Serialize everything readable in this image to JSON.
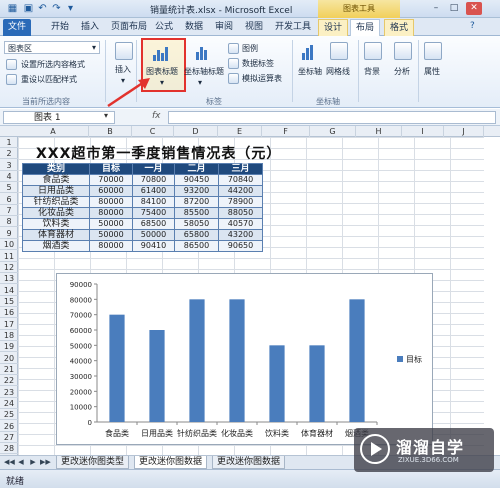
{
  "window": {
    "title": "销量统计表.xlsx - Microsoft Excel",
    "context_header": "图表工具",
    "min_label": "–",
    "max_label": "□",
    "close_label": "✕"
  },
  "tabs": [
    "文件",
    "开始",
    "插入",
    "页面布局",
    "公式",
    "数据",
    "审阅",
    "视图",
    "开发工具",
    "设计",
    "布局",
    "格式"
  ],
  "ribbon": {
    "chart_area_dropdown": "图表区",
    "format_selection": "设置所选内容格式",
    "reset_style": "重设以匹配样式",
    "group_current_selection": "当前所选内容",
    "insert": "插入",
    "chart_title": "图表标题",
    "axis_titles": "坐标轴标题",
    "legend": "图例",
    "data_labels": "数据标签",
    "data_table": "模拟运算表",
    "group_labels": "标签",
    "axes": "坐标轴",
    "gridlines": "网格线",
    "group_axes": "坐标轴",
    "background": "背景",
    "analysis": "分析",
    "properties": "属性"
  },
  "namebox": {
    "value": "图表 1"
  },
  "formula": {
    "fx": "fx",
    "value": ""
  },
  "columns": [
    "A",
    "B",
    "C",
    "D",
    "E",
    "F",
    "G",
    "H",
    "I",
    "J"
  ],
  "rows": [
    "1",
    "2",
    "3",
    "4",
    "5",
    "6",
    "7",
    "8",
    "9",
    "10",
    "11",
    "12",
    "13",
    "14",
    "15",
    "16",
    "17",
    "18",
    "19",
    "20",
    "21",
    "22",
    "23",
    "24",
    "25",
    "26",
    "27",
    "28"
  ],
  "sheet": {
    "title": "XXX超市第一季度销售情况表（元）",
    "headers": [
      "类别",
      "目标",
      "一月",
      "二月",
      "三月"
    ],
    "data": [
      [
        "食品类",
        "70000",
        "70800",
        "90450",
        "70840"
      ],
      [
        "日用品类",
        "60000",
        "61400",
        "93200",
        "44200"
      ],
      [
        "针纺织品类",
        "80000",
        "84100",
        "87200",
        "78900"
      ],
      [
        "化妆品类",
        "80000",
        "75400",
        "85500",
        "88050"
      ],
      [
        "饮料类",
        "50000",
        "68500",
        "58050",
        "40570"
      ],
      [
        "体育器材",
        "50000",
        "50000",
        "65800",
        "43200"
      ],
      [
        "烟酒类",
        "80000",
        "90410",
        "86500",
        "90650"
      ]
    ]
  },
  "chart_data": {
    "type": "bar",
    "categories": [
      "食品类",
      "日用品类",
      "针纺织品类",
      "化妆品类",
      "饮料类",
      "体育器材",
      "烟酒类"
    ],
    "series": [
      {
        "name": "目标",
        "values": [
          70000,
          60000,
          80000,
          80000,
          50000,
          50000,
          80000
        ],
        "color": "#4a7dbd"
      }
    ],
    "yticks": [
      "0",
      "10000",
      "20000",
      "30000",
      "40000",
      "50000",
      "60000",
      "70000",
      "80000",
      "90000"
    ],
    "ylim": [
      0,
      90000
    ],
    "legend": "right",
    "grid": false
  },
  "sheet_tabs": [
    "更改迷你图类型",
    "更改迷你图数据",
    "更改迷你图数据"
  ],
  "status": {
    "ready": "就绪"
  },
  "watermark": {
    "brand": "溜溜自学",
    "url": "ZIXUE.3D66.COM"
  },
  "colors": {
    "header_blue": "#1f497d",
    "ribbon_accent": "#2a6ab8",
    "highlight_red": "#e2322d"
  }
}
